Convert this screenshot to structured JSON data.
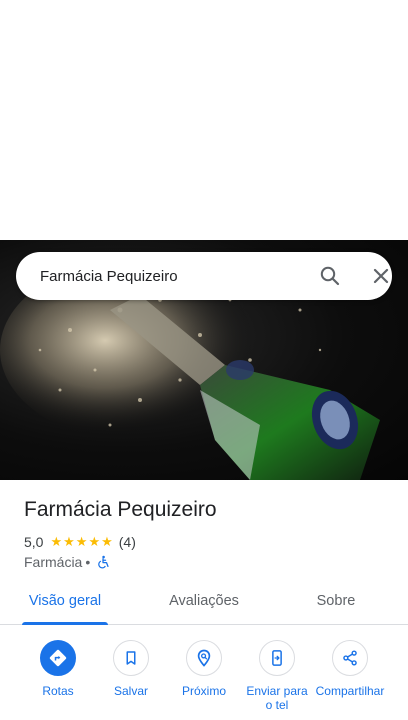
{
  "search": {
    "query": "Farmácia Pequizeiro",
    "search_icon": "search-icon",
    "close_icon": "close-icon"
  },
  "place": {
    "name": "Farmácia Pequizeiro",
    "rating": "5,0",
    "stars": 5,
    "review_count": "(4)",
    "category": "Farmácia",
    "separator": "•",
    "accessibility_icon": "wheelchair-icon"
  },
  "tabs": [
    {
      "label": "Visão geral",
      "active": true
    },
    {
      "label": "Avaliações",
      "active": false
    },
    {
      "label": "Sobre",
      "active": false
    }
  ],
  "actions": [
    {
      "label": "Rotas",
      "icon": "directions-icon"
    },
    {
      "label": "Salvar",
      "icon": "bookmark-icon"
    },
    {
      "label": "Próximo",
      "icon": "nearby-icon"
    },
    {
      "label": "Enviar para o tel",
      "icon": "send-to-phone-icon"
    },
    {
      "label": "Compartilhar",
      "icon": "share-icon"
    }
  ],
  "colors": {
    "accent": "#1a73e8",
    "star": "#fbbc04",
    "text_primary": "#202124",
    "text_secondary": "#5f6368"
  }
}
